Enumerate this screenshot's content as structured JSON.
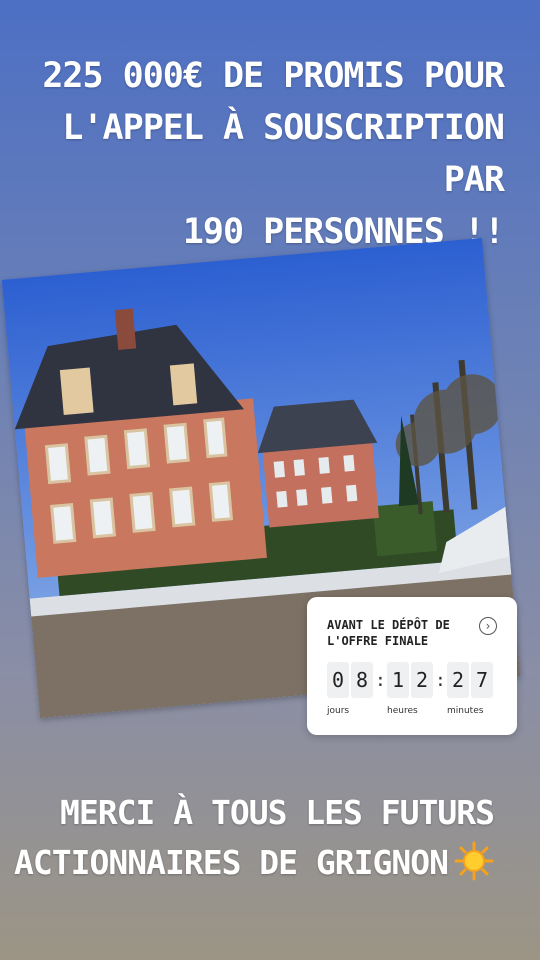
{
  "headline": {
    "line1": "225 000€ DE PROMIS POUR",
    "line2": "L'APPEL À SOUSCRIPTION PAR",
    "line3": "190 PERSONNES !!"
  },
  "countdown": {
    "title_line1": "AVANT LE DÉPÔT DE",
    "title_line2": "L'OFFRE FINALE",
    "digits": {
      "d1": "0",
      "d2": "8",
      "h1": "1",
      "h2": "2",
      "m1": "2",
      "m2": "7"
    },
    "separator": ":",
    "labels": {
      "days": "jours",
      "hours": "heures",
      "minutes": "minutes"
    },
    "arrow_icon": "chevron-right-circle-icon"
  },
  "footer": {
    "line1": "MERCI À TOUS LES FUTURS",
    "line2": "ACTIONNAIRES DE GRIGNON",
    "emoji_icon": "sun-icon"
  },
  "colors": {
    "bg_top": "#4d6fc4",
    "bg_bottom": "#9c9585",
    "text": "#ffffff",
    "sticker_bg": "#ffffff"
  }
}
